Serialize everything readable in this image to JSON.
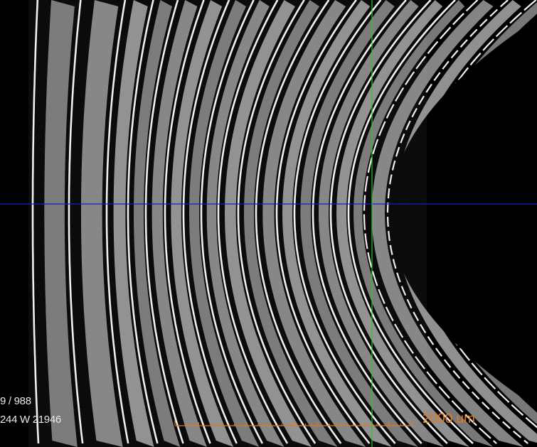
{
  "viewer": {
    "slice_indicator": "9 / 988",
    "window_level": "244 W 21946",
    "scale_bar_label": "2000 um"
  },
  "colors": {
    "background": "#000000",
    "crosshair_horizontal": "#1a1ad0",
    "crosshair_vertical": "#22cc22",
    "scale_bar": "#e07a1f",
    "overlay_text": "#e8e8e8"
  },
  "icons": {
    "crosshair": "crosshair-icon",
    "scale_bar": "scale-bar-icon"
  }
}
